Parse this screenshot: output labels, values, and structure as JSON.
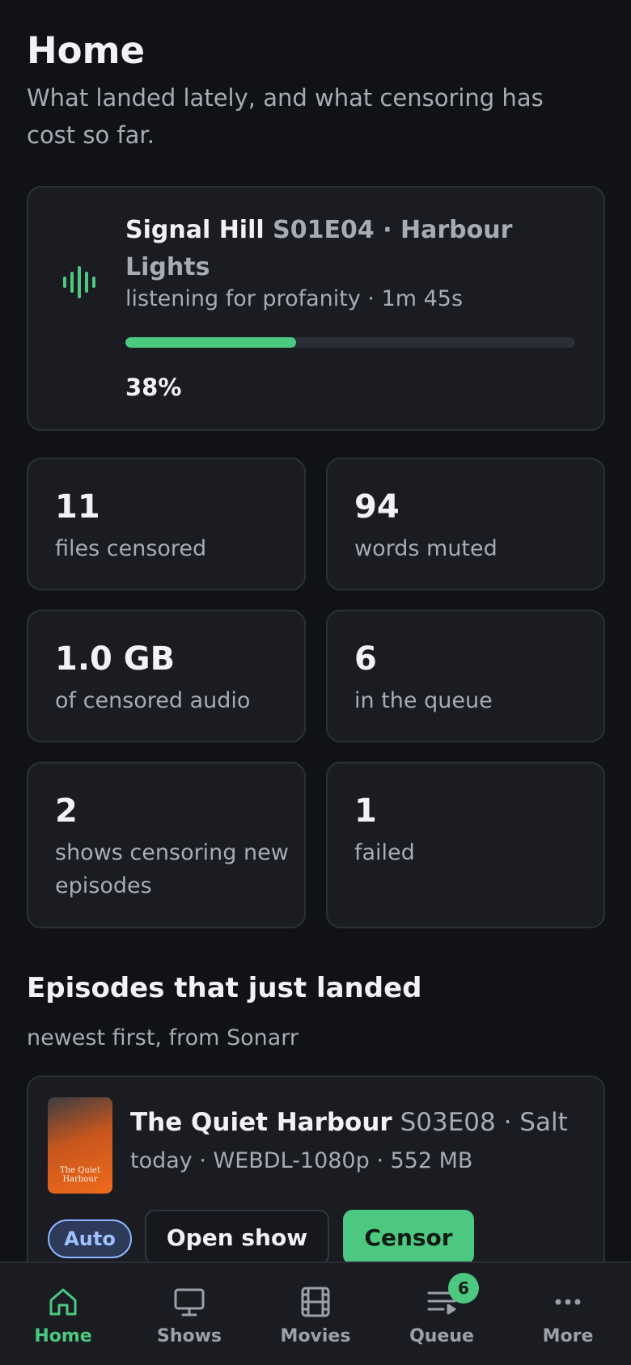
{
  "header": {
    "title": "Home",
    "subtitle": "What landed lately, and what censoring has cost so far."
  },
  "now_processing": {
    "show": "Signal Hill",
    "episode": "S01E04 · Harbour Lights",
    "status": "listening for profanity · 1m 45s",
    "progress": 0.38,
    "percent_label": "38%",
    "icon": "waveform-icon"
  },
  "stats": [
    {
      "value": "11",
      "label": "files censored"
    },
    {
      "value": "94",
      "label": "words muted"
    },
    {
      "value": "1.0 GB",
      "label": "of censored audio"
    },
    {
      "value": "6",
      "label": "in the queue"
    },
    {
      "value": "2",
      "label": "shows censoring new episodes"
    },
    {
      "value": "1",
      "label": "failed"
    }
  ],
  "recent": {
    "title": "Episodes that just landed",
    "subtitle": "newest first, from Sonarr",
    "items": [
      {
        "poster_text": "The Quiet Harbour",
        "show": "The Quiet Harbour",
        "episode": "S03E08 · Salt",
        "meta": "today · WEBDL-1080p · 552 MB",
        "mode": "Auto",
        "open_label": "Open show",
        "censor_label": "Censor"
      }
    ]
  },
  "tabbar": {
    "items": [
      {
        "label": "Home",
        "icon": "home-icon",
        "active": true
      },
      {
        "label": "Shows",
        "icon": "monitor-icon"
      },
      {
        "label": "Movies",
        "icon": "film-icon"
      },
      {
        "label": "Queue",
        "icon": "queue-icon",
        "badge": "6"
      },
      {
        "label": "More",
        "icon": "more-icon"
      }
    ]
  },
  "colors": {
    "background": "#111216",
    "card": "#1a1c22",
    "accent": "#4cc880",
    "muted": "#a7abb5",
    "auto_pill": "#8fb4ff"
  }
}
